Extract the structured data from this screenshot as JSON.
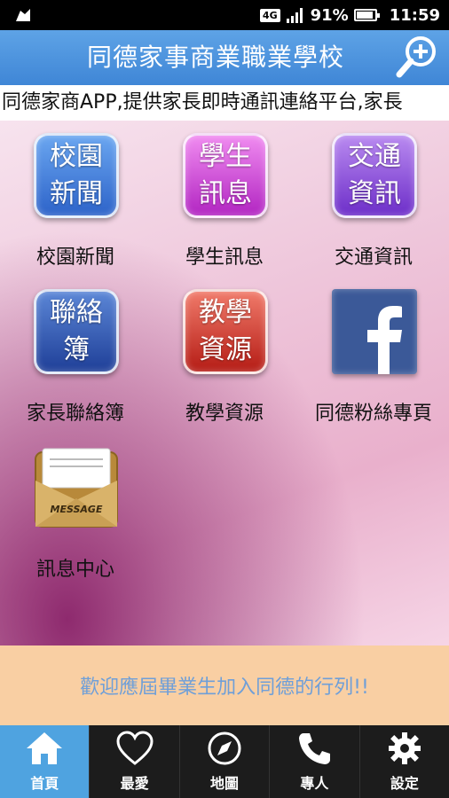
{
  "status_bar": {
    "network": "4G",
    "battery": "91%",
    "battery_level": 0.91,
    "time": "11:59"
  },
  "header": {
    "title": "同德家事商業職業學校"
  },
  "marquee": {
    "text": "同德家商APP,提供家長即時通訊連絡平台,家長"
  },
  "tiles": [
    {
      "icon_lines": [
        "校園",
        "新聞"
      ],
      "label": "校園新聞",
      "color": "#2d63c9"
    },
    {
      "icon_lines": [
        "學生",
        "訊息"
      ],
      "label": "學生訊息",
      "color": "#b225c2"
    },
    {
      "icon_lines": [
        "交通",
        "資訊"
      ],
      "label": "交通資訊",
      "color": "#6d2ec9"
    },
    {
      "icon_lines": [
        "聯絡",
        "簿"
      ],
      "label": "家長聯絡簿",
      "color": "#1f3f98"
    },
    {
      "icon_lines": [
        "教學",
        "資源"
      ],
      "label": "教學資源",
      "color": "#b51c15"
    },
    {
      "icon_name": "facebook-icon",
      "label": "同德粉絲專頁",
      "color": "#3b5998"
    },
    {
      "icon_name": "message-envelope-icon",
      "icon_text": "MESSAGE",
      "label": "訊息中心"
    }
  ],
  "banner": {
    "text": "歡迎應屆畢業生加入同德的行列!!"
  },
  "bottom_nav": [
    {
      "label": "首頁",
      "icon": "home-icon",
      "active": true
    },
    {
      "label": "最愛",
      "icon": "heart-icon",
      "active": false
    },
    {
      "label": "地圖",
      "icon": "compass-icon",
      "active": false
    },
    {
      "label": "專人",
      "icon": "phone-icon",
      "active": false
    },
    {
      "label": "設定",
      "icon": "gear-icon",
      "active": false
    }
  ],
  "colors": {
    "title_bar": "#4a90de",
    "banner_bg": "#f9cfa3",
    "banner_text": "#6f9fd8",
    "nav_active": "#4fa3e0"
  }
}
